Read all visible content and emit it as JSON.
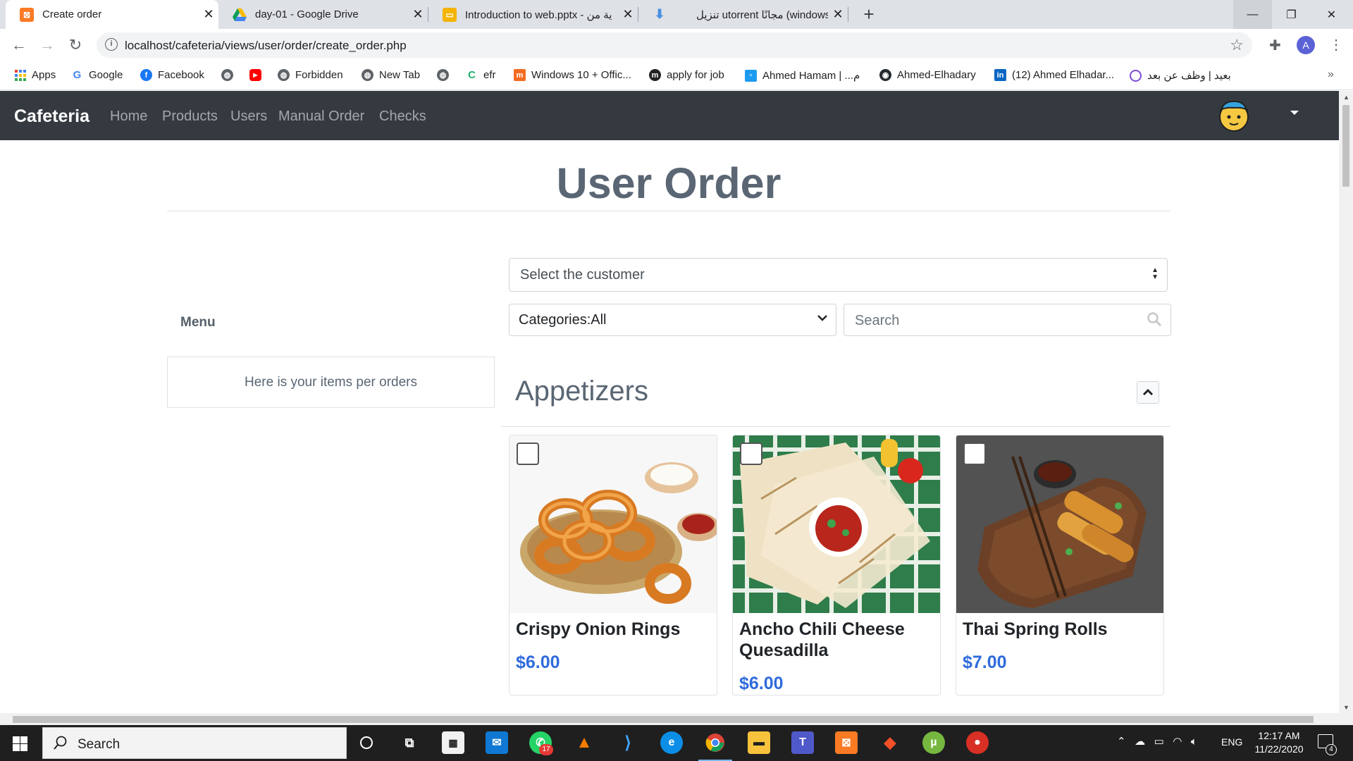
{
  "browser": {
    "tabs": [
      {
        "title": "Create order",
        "active": true,
        "favicon": "xampp-icon"
      },
      {
        "title": "day-01 - Google Drive",
        "favicon": "google-drive-icon"
      },
      {
        "title": "Introduction to web.pptx - ية من",
        "favicon": "google-slides-icon"
      },
      {
        "title": "تنزيل utorrent مجانًا (windows)",
        "favicon": "download-icon"
      }
    ],
    "url": "localhost/cafeteria/views/user/order/create_order.php",
    "profile_initial": "A",
    "bookmarks": [
      {
        "label": "Apps",
        "icon": "apps-grid-icon"
      },
      {
        "label": "Google",
        "icon": "google-icon"
      },
      {
        "label": "Facebook",
        "icon": "facebook-icon"
      },
      {
        "label": "",
        "icon": "globe-icon"
      },
      {
        "label": "",
        "icon": "youtube-icon"
      },
      {
        "label": "Forbidden",
        "icon": "globe-icon"
      },
      {
        "label": "New Tab",
        "icon": "globe-icon"
      },
      {
        "label": "",
        "icon": "globe-icon"
      },
      {
        "label": "efr",
        "icon": "c-icon"
      },
      {
        "label": "Windows 10 + Offic...",
        "icon": "m-icon"
      },
      {
        "label": "apply for job",
        "icon": "m-circle-icon"
      },
      {
        "label": "Ahmed Hamam | ...م",
        "icon": "square-icon"
      },
      {
        "label": "Ahmed-Elhadary",
        "icon": "github-icon"
      },
      {
        "label": "(12) Ahmed Elhadar...",
        "icon": "linkedin-icon"
      },
      {
        "label": "بعيد | وظف عن بعد",
        "icon": "remote-icon"
      }
    ],
    "more_bookmarks": "»"
  },
  "navbar": {
    "brand": "Cafeteria",
    "links": [
      "Home",
      "Products",
      "Users",
      "Manual Order",
      "Checks"
    ]
  },
  "page": {
    "title": "User Order",
    "menu_label": "Menu",
    "menu_placeholder": "Here is your items per orders",
    "customer_select": "Select the customer",
    "category_select": "Categories:All",
    "search_placeholder": "Search",
    "section_title": "Appetizers",
    "products": [
      {
        "name": "Crispy Onion Rings",
        "price": "$6.00"
      },
      {
        "name": "Ancho Chili Cheese Quesadilla",
        "price": "$6.00"
      },
      {
        "name": "Thai Spring Rolls",
        "price": "$7.00"
      }
    ]
  },
  "taskbar": {
    "search_placeholder": "Search",
    "whatsapp_badge": "17",
    "language": "ENG",
    "time": "12:17 AM",
    "date": "11/22/2020",
    "notifications": "4"
  },
  "colors": {
    "navbar_bg": "#343a40",
    "price": "#2f6bdc",
    "title": "#5a6673"
  }
}
